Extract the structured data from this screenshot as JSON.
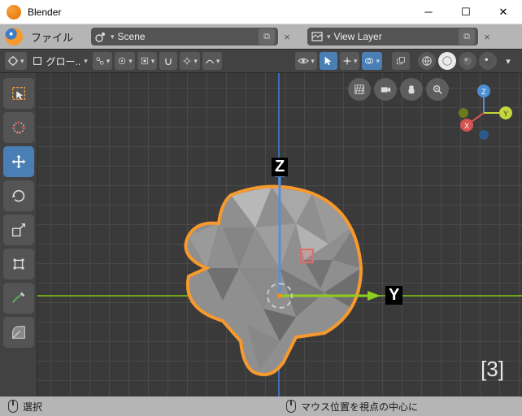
{
  "window": {
    "title": "Blender"
  },
  "menubar": {
    "file": "ファイル",
    "scene_field": "Scene",
    "viewlayer_field": "View Layer"
  },
  "header": {
    "mode_label": "グロー.."
  },
  "viewport": {
    "axis_z": "Z",
    "axis_y": "Y",
    "persp_label": "[3]",
    "gizmo": {
      "x": "X",
      "y": "Y",
      "z": "Z"
    }
  },
  "status": {
    "left": "選択",
    "right": "マウス位置を視点の中心に"
  }
}
